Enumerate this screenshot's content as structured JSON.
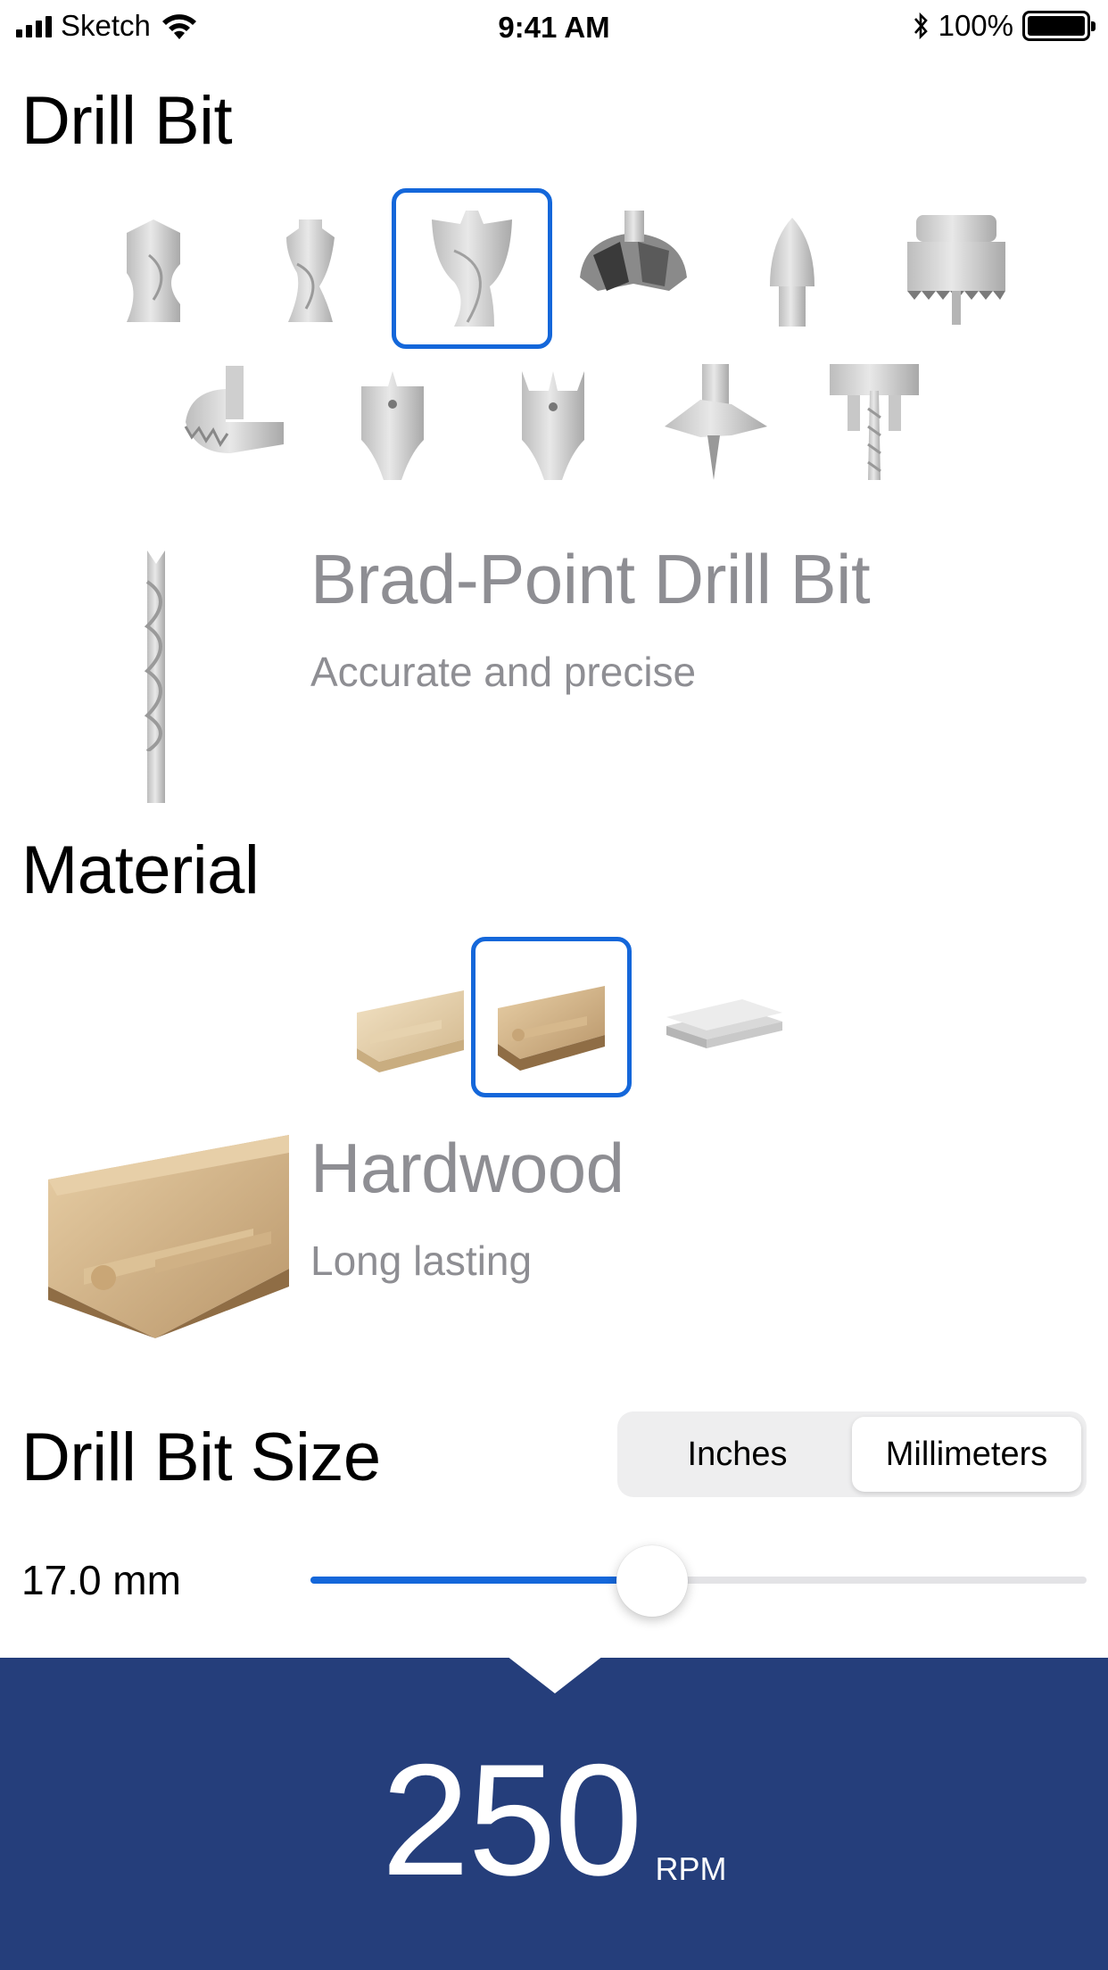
{
  "status_bar": {
    "carrier": "Sketch",
    "time": "9:41 AM",
    "battery": "100%"
  },
  "drill_bit": {
    "section_title": "Drill Bit",
    "options": [
      {
        "icon": "twist-bit-icon",
        "selected": false
      },
      {
        "icon": "twist-bit-tapered-icon",
        "selected": false
      },
      {
        "icon": "brad-point-bit-icon",
        "selected": true
      },
      {
        "icon": "forstner-bit-icon",
        "selected": false
      },
      {
        "icon": "countersink-bit-icon",
        "selected": false
      },
      {
        "icon": "hole-saw-icon",
        "selected": false
      },
      {
        "icon": "circle-cutter-icon",
        "selected": false
      },
      {
        "icon": "spade-bit-icon",
        "selected": false
      },
      {
        "icon": "spade-bit-spur-icon",
        "selected": false
      },
      {
        "icon": "auger-bit-icon",
        "selected": false
      },
      {
        "icon": "plug-cutter-icon",
        "selected": false
      }
    ],
    "selected_name": "Brad-Point Drill Bit",
    "selected_desc": "Accurate and precise"
  },
  "material": {
    "section_title": "Material",
    "options": [
      {
        "icon": "softwood-icon",
        "selected": false
      },
      {
        "icon": "hardwood-icon",
        "selected": true
      },
      {
        "icon": "metal-sheet-icon",
        "selected": false
      }
    ],
    "selected_name": "Hardwood",
    "selected_desc": "Long lasting"
  },
  "size": {
    "section_title": "Drill Bit Size",
    "units": [
      "Inches",
      "Millimeters"
    ],
    "active_unit": "Millimeters",
    "value_label": "17.0 mm",
    "slider_fraction": 0.44
  },
  "result": {
    "rpm": "250",
    "unit": "RPM"
  },
  "colors": {
    "accent": "#1467da",
    "panel": "#253e7b",
    "secondary_text": "#8e8e93"
  }
}
